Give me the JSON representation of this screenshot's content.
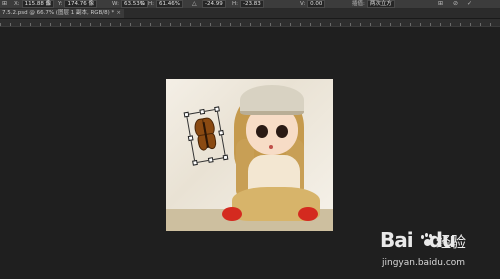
{
  "options_bar": {
    "x_value": "115.88 像",
    "y_value": "174.76 像",
    "w_label": "W:",
    "w_value": "63.53%",
    "h_label": "H:",
    "h_value": "61.46%",
    "angle_value": "-24.99",
    "hskew_label": "H:",
    "hskew_value": "-23.83",
    "vskew_label": "V:",
    "vskew_value": "0.00",
    "interp_label": "插值:",
    "interp_value": "两次立方"
  },
  "document_tab": {
    "title": "7.5.2.psd @ 66.7% (图层 1 副本, RGB/8) *",
    "close": "×"
  },
  "watermark": {
    "logo": "Bai",
    "logo_suffix": "du",
    "text": "经验",
    "url": "jingyan.baidu.com"
  }
}
